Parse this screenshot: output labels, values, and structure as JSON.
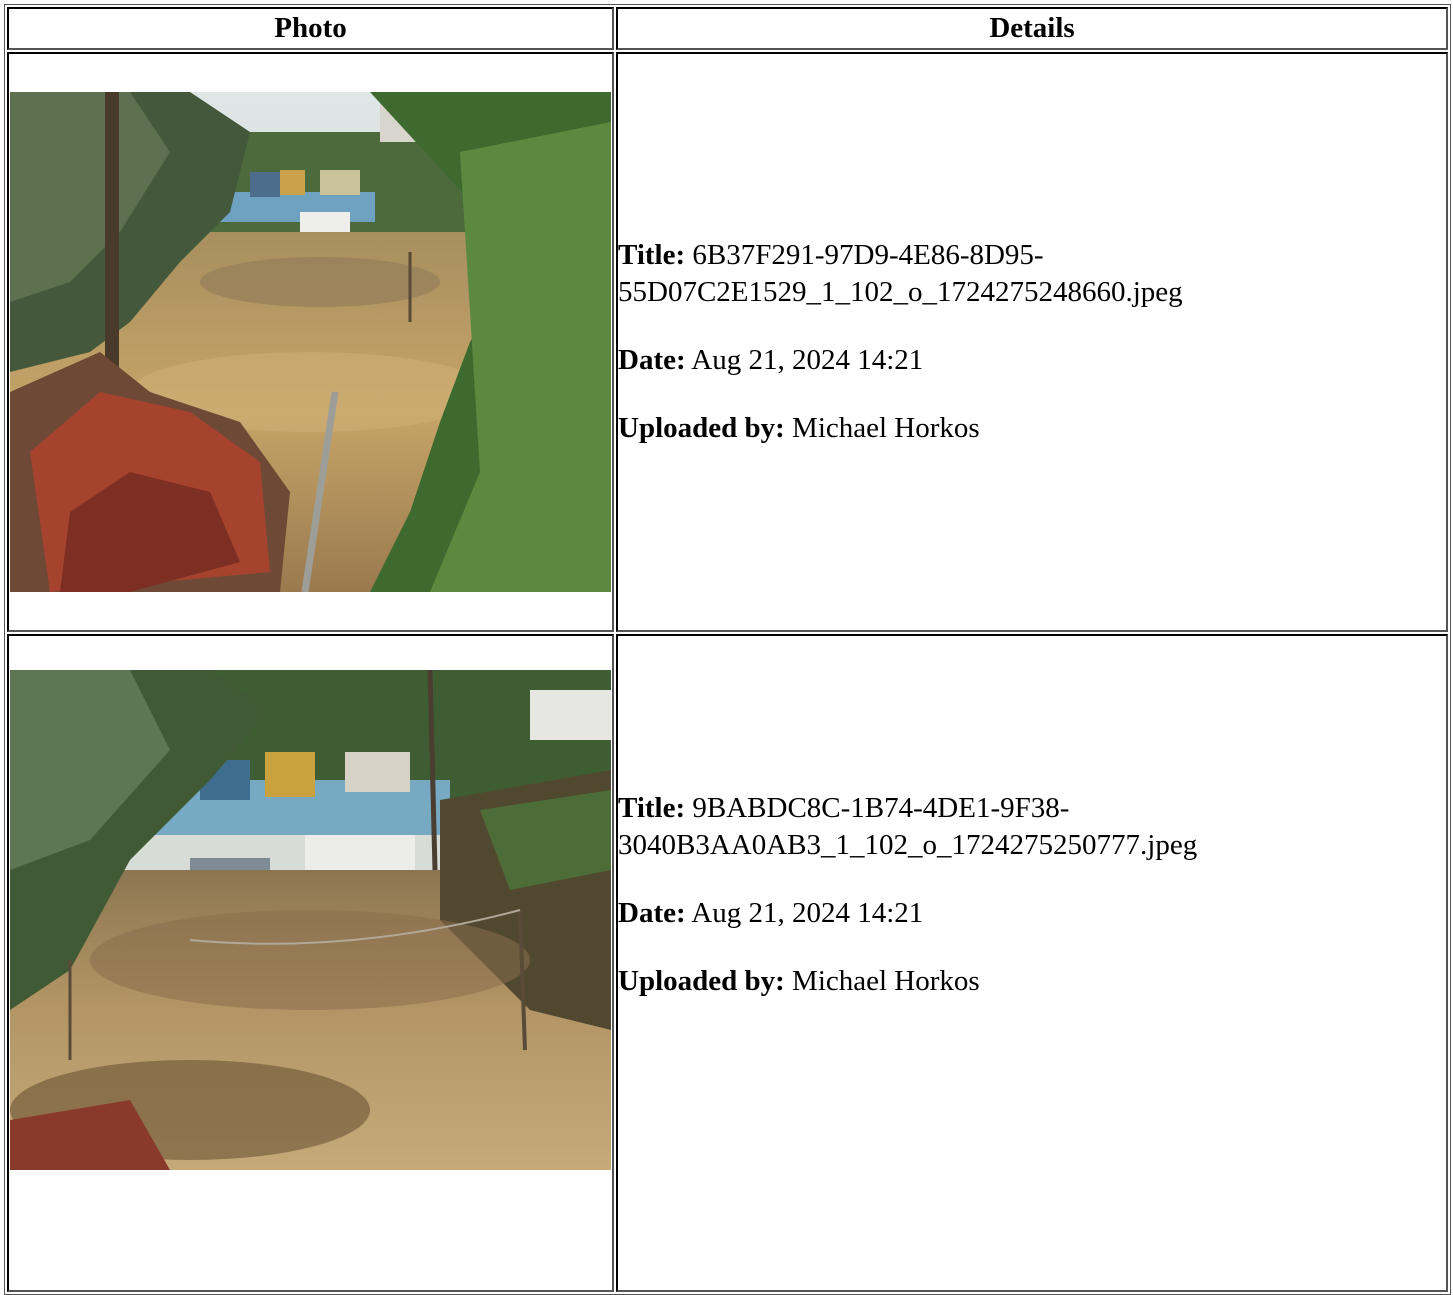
{
  "headers": {
    "photo": "Photo",
    "details": "Details"
  },
  "labels": {
    "title": "Title:",
    "date": "Date:",
    "uploaded_by": "Uploaded by:"
  },
  "rows": [
    {
      "title": "6B37F291-97D9-4E86-8D95-\n55D07C2E1529_1_102_o_1724275248660.jpeg",
      "date": "Aug 21, 2024 14:21",
      "uploaded_by": "Michael Horkos"
    },
    {
      "title": "9BABDC8C-1B74-4DE1-9F38-\n3040B3AA0AB3_1_102_o_1724275250777.jpeg",
      "date": "Aug 21, 2024 14:21",
      "uploaded_by": "Michael Horkos"
    }
  ]
}
